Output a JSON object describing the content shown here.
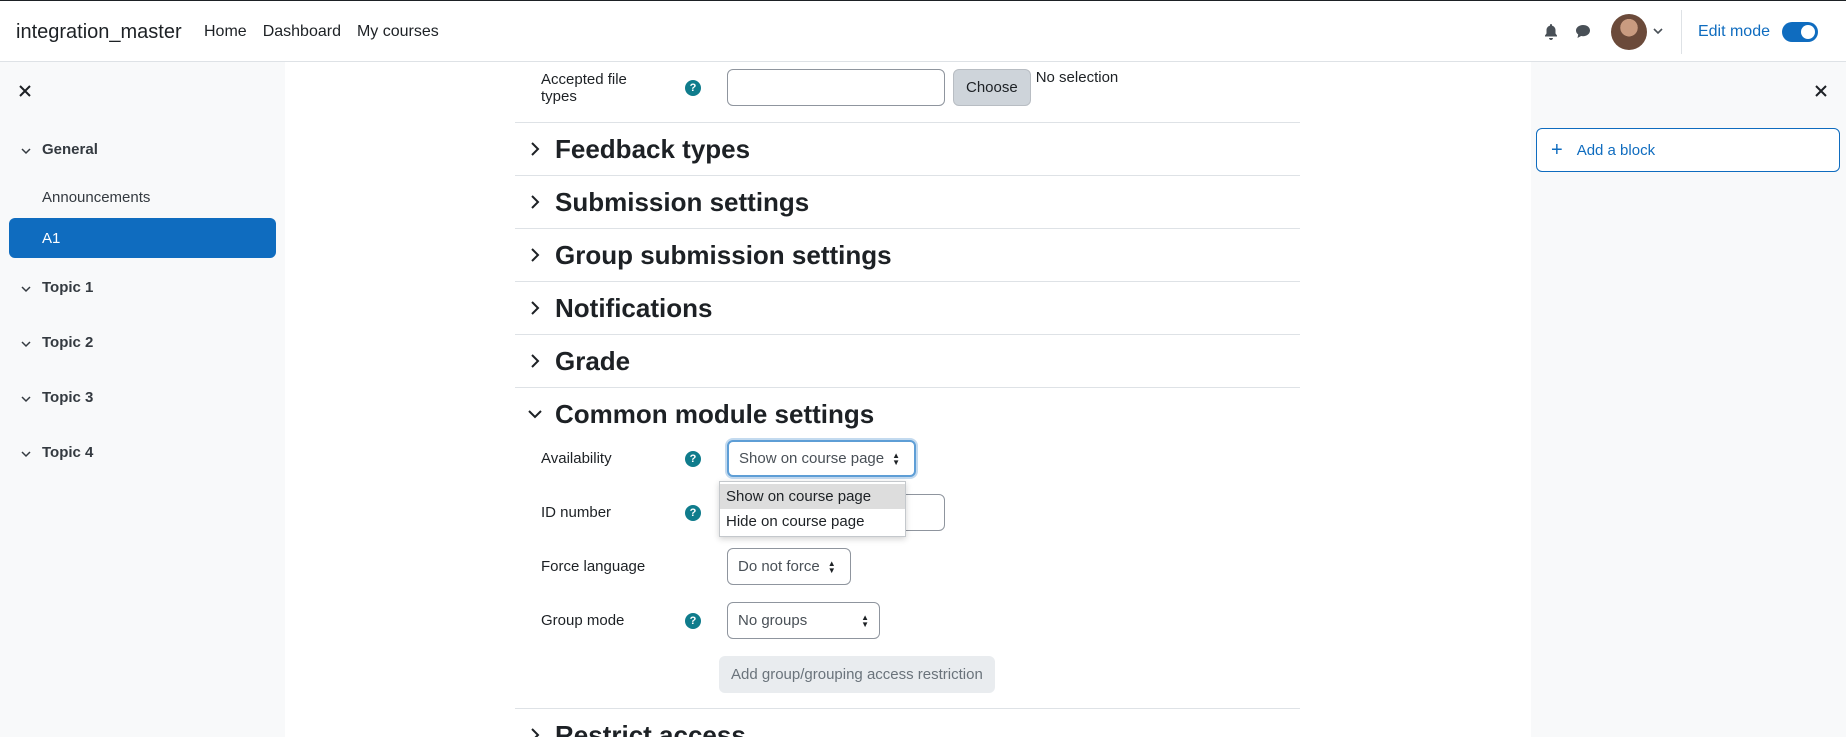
{
  "navbar": {
    "brand": "integration_master",
    "links": [
      "Home",
      "Dashboard",
      "My courses"
    ],
    "edit_mode_label": "Edit mode",
    "edit_mode_on": true,
    "icons": [
      "bell-icon",
      "chat-icon"
    ]
  },
  "course_index": {
    "sections": [
      {
        "label": "General",
        "expanded": true,
        "items": [
          "Announcements",
          "A1"
        ],
        "active_item": "A1"
      },
      {
        "label": "Topic 1",
        "expanded": true,
        "items": []
      },
      {
        "label": "Topic 2",
        "expanded": true,
        "items": []
      },
      {
        "label": "Topic 3",
        "expanded": true,
        "items": []
      },
      {
        "label": "Topic 4",
        "expanded": true,
        "items": []
      }
    ]
  },
  "form": {
    "accepted_file_types": {
      "label": "Accepted file types",
      "value": "",
      "choose_label": "Choose",
      "selection_text": "No selection"
    },
    "sections": [
      {
        "title": "Feedback types",
        "expanded": false
      },
      {
        "title": "Submission settings",
        "expanded": false
      },
      {
        "title": "Group submission settings",
        "expanded": false
      },
      {
        "title": "Notifications",
        "expanded": false
      },
      {
        "title": "Grade",
        "expanded": false
      },
      {
        "title": "Common module settings",
        "expanded": true
      },
      {
        "title": "Restrict access",
        "expanded": false
      }
    ],
    "availability": {
      "label": "Availability",
      "selected": "Show on course page",
      "options": [
        "Show on course page",
        "Hide on course page"
      ]
    },
    "id_number": {
      "label": "ID number",
      "value": ""
    },
    "force_language": {
      "label": "Force language",
      "selected": "Do not force"
    },
    "group_mode": {
      "label": "Group mode",
      "selected": "No groups"
    },
    "restriction_button": "Add group/grouping access restriction"
  },
  "blocks": {
    "add_block_label": "Add a block"
  },
  "colors": {
    "primary": "#0f6cbf",
    "help_icon": "#0f7c8c",
    "drawer_bg": "#f8f9fa"
  }
}
